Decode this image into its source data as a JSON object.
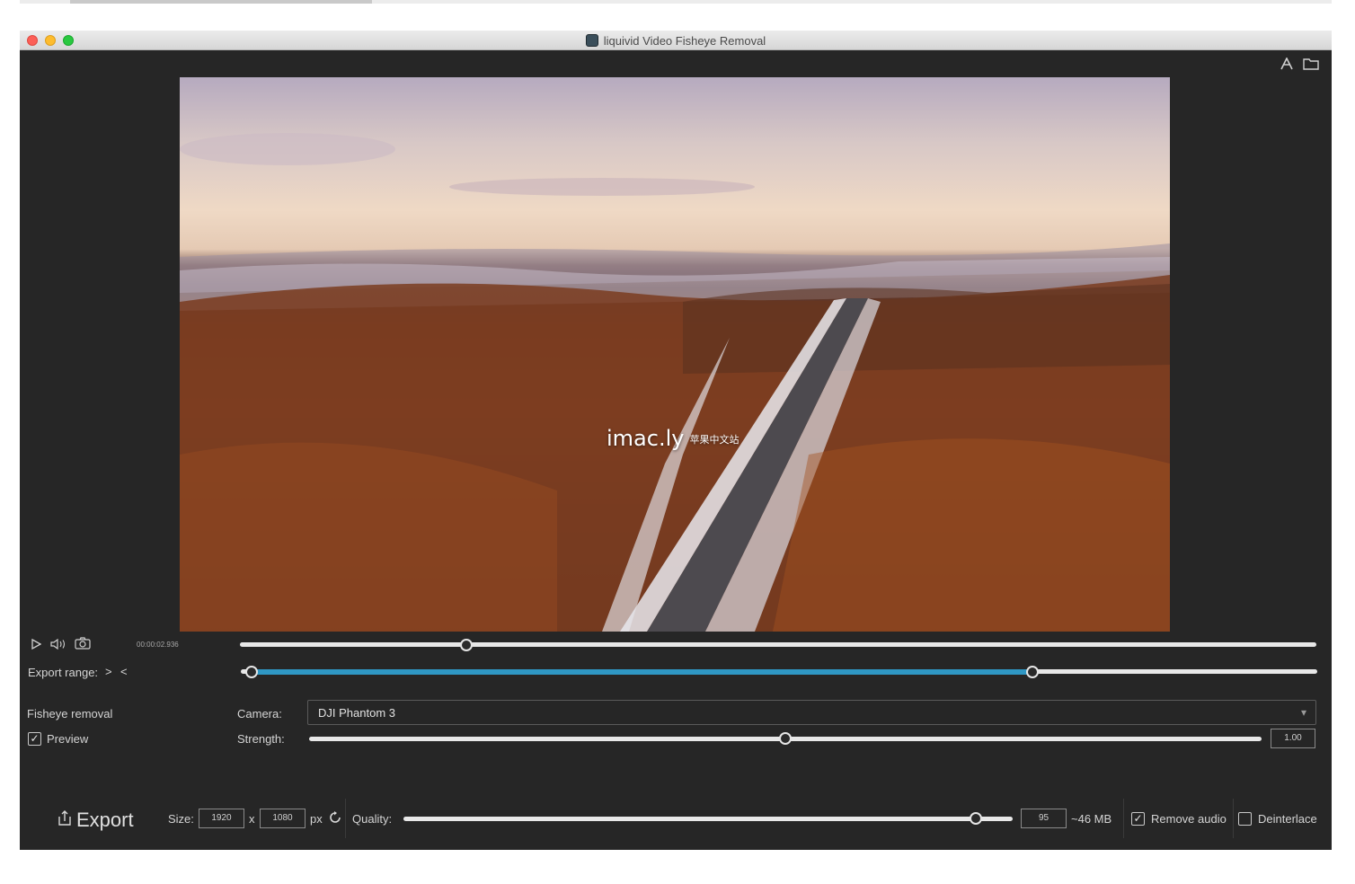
{
  "window": {
    "title": "liquivid Video Fisheye Removal"
  },
  "toolbar": {
    "icons": [
      "text-overlay-icon",
      "folder-icon"
    ]
  },
  "video": {
    "watermark_main": "imac.ly",
    "watermark_sub": "苹果中文站"
  },
  "playback": {
    "icons": [
      "play-icon",
      "volume-icon",
      "camera-icon"
    ],
    "timecode": "00:00:02.936",
    "position": 0.21
  },
  "export_range": {
    "label": "Export range:",
    "in_icon": ">",
    "out_icon": "<",
    "start": 0.01,
    "end": 0.735
  },
  "fisheye": {
    "title": "Fisheye removal",
    "preview_label": "Preview",
    "preview_checked": true,
    "camera_label": "Camera:",
    "camera_value": "DJI Phantom 3",
    "strength_label": "Strength:",
    "strength_value": "1.00",
    "strength_position": 0.5
  },
  "export": {
    "button_label": "Export",
    "size_label": "Size:",
    "width": "1920",
    "x_sep": "x",
    "height": "1080",
    "unit": "px",
    "quality_label": "Quality:",
    "quality_value": "95",
    "quality_position": 0.94,
    "file_size": "~46 MB",
    "remove_audio_label": "Remove audio",
    "remove_audio_checked": true,
    "deinterlace_label": "Deinterlace",
    "deinterlace_checked": false
  },
  "colors": {
    "background": "#262626",
    "accent": "#2f97c4",
    "text": "#d4d4d4"
  }
}
